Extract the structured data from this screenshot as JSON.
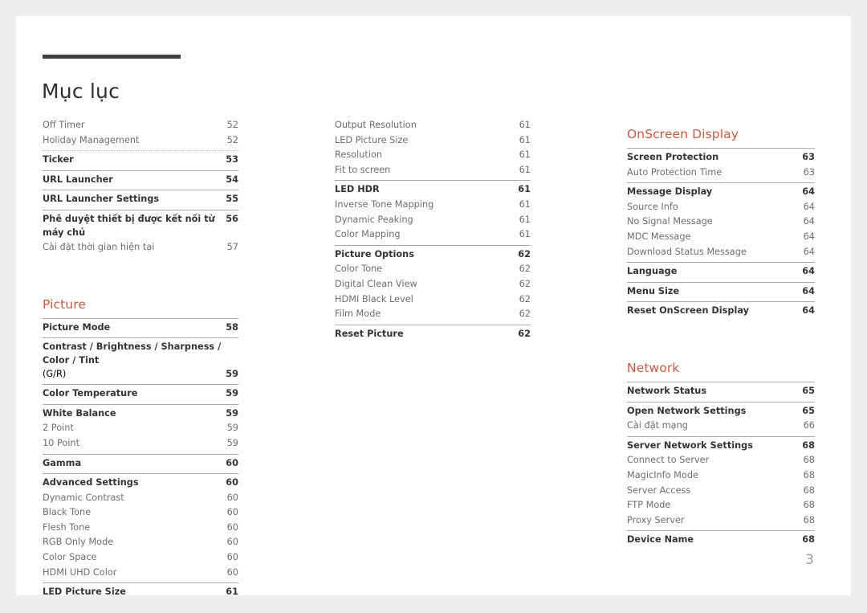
{
  "document": {
    "title": "Mục lục",
    "folio": "3",
    "accent_color": "#d9563a",
    "rule_color": "#3f3f4a"
  },
  "columns": [
    {
      "name": "column-1",
      "groups": [
        {
          "style": "plain",
          "rows": [
            {
              "label": "Off Timer",
              "page": "52",
              "level": 2
            },
            {
              "label": "Holiday Management",
              "page": "52",
              "level": 2
            }
          ]
        },
        {
          "style": "dotted",
          "rows": [
            {
              "label": "Ticker",
              "page": "53",
              "level": 1
            }
          ]
        },
        {
          "style": "solid",
          "rows": [
            {
              "label": "URL Launcher",
              "page": "54",
              "level": 1
            }
          ]
        },
        {
          "style": "solid",
          "rows": [
            {
              "label": "URL Launcher Settings",
              "page": "55",
              "level": 1
            }
          ]
        },
        {
          "style": "solid",
          "rows": [
            {
              "label": "Phê duyệt thiết bị được kết nối từ máy chủ",
              "page": "56",
              "level": 1
            },
            {
              "label": "Cài đặt thời gian hiện tại",
              "page": "57",
              "level": 2
            }
          ]
        }
      ],
      "section": {
        "heading": "Picture",
        "groups": [
          {
            "style": "solid",
            "rows": [
              {
                "label": "Picture Mode",
                "page": "58",
                "level": 1
              }
            ]
          },
          {
            "style": "solid",
            "rows": [
              {
                "label": "Contrast / Brightness / Sharpness / Color / Tint",
                "label2": "(G/R)",
                "page": "59",
                "level": 1,
                "wrap": true
              }
            ]
          },
          {
            "style": "solid",
            "rows": [
              {
                "label": "Color Temperature",
                "page": "59",
                "level": 1
              }
            ]
          },
          {
            "style": "solid",
            "rows": [
              {
                "label": "White Balance",
                "page": "59",
                "level": 1
              },
              {
                "label": "2 Point",
                "page": "59",
                "level": 2
              },
              {
                "label": "10 Point",
                "page": "59",
                "level": 2
              }
            ]
          },
          {
            "style": "solid",
            "rows": [
              {
                "label": "Gamma",
                "page": "60",
                "level": 1
              }
            ]
          },
          {
            "style": "solid",
            "rows": [
              {
                "label": "Advanced Settings",
                "page": "60",
                "level": 1
              },
              {
                "label": "Dynamic Contrast",
                "page": "60",
                "level": 2
              },
              {
                "label": "Black Tone",
                "page": "60",
                "level": 2
              },
              {
                "label": "Flesh Tone",
                "page": "60",
                "level": 2
              },
              {
                "label": "RGB Only Mode",
                "page": "60",
                "level": 2
              },
              {
                "label": "Color Space",
                "page": "60",
                "level": 2
              },
              {
                "label": "HDMI UHD Color",
                "page": "60",
                "level": 2
              }
            ]
          },
          {
            "style": "solid",
            "rows": [
              {
                "label": "LED Picture Size",
                "page": "61",
                "level": 1
              }
            ]
          }
        ]
      }
    },
    {
      "name": "column-2",
      "groups": [
        {
          "style": "plain",
          "rows": [
            {
              "label": "Output Resolution",
              "page": "61",
              "level": 2
            },
            {
              "label": "LED Picture Size",
              "page": "61",
              "level": 2
            },
            {
              "label": "Resolution",
              "page": "61",
              "level": 2
            },
            {
              "label": "Fit to screen",
              "page": "61",
              "level": 2
            }
          ]
        },
        {
          "style": "solid",
          "rows": [
            {
              "label": "LED HDR",
              "page": "61",
              "level": 1
            },
            {
              "label": "Inverse Tone Mapping",
              "page": "61",
              "level": 2
            },
            {
              "label": "Dynamic Peaking",
              "page": "61",
              "level": 2
            },
            {
              "label": "Color Mapping",
              "page": "61",
              "level": 2
            }
          ]
        },
        {
          "style": "solid",
          "rows": [
            {
              "label": "Picture Options",
              "page": "62",
              "level": 1
            },
            {
              "label": "Color Tone",
              "page": "62",
              "level": 2
            },
            {
              "label": "Digital Clean View",
              "page": "62",
              "level": 2
            },
            {
              "label": "HDMI Black Level",
              "page": "62",
              "level": 2
            },
            {
              "label": "Film Mode",
              "page": "62",
              "level": 2
            }
          ]
        },
        {
          "style": "solid",
          "rows": [
            {
              "label": "Reset Picture",
              "page": "62",
              "level": 1
            }
          ]
        }
      ]
    },
    {
      "name": "column-3",
      "sections": [
        {
          "heading": "OnScreen Display",
          "groups": [
            {
              "style": "solid",
              "rows": [
                {
                  "label": "Screen Protection",
                  "page": "63",
                  "level": 1
                },
                {
                  "label": "Auto Protection Time",
                  "page": "63",
                  "level": 2
                }
              ]
            },
            {
              "style": "solid",
              "rows": [
                {
                  "label": "Message Display",
                  "page": "64",
                  "level": 1
                },
                {
                  "label": "Source Info",
                  "page": "64",
                  "level": 2
                },
                {
                  "label": "No Signal Message",
                  "page": "64",
                  "level": 2
                },
                {
                  "label": "MDC Message",
                  "page": "64",
                  "level": 2
                },
                {
                  "label": "Download Status Message",
                  "page": "64",
                  "level": 2
                }
              ]
            },
            {
              "style": "solid",
              "rows": [
                {
                  "label": "Language",
                  "page": "64",
                  "level": 1
                }
              ]
            },
            {
              "style": "solid",
              "rows": [
                {
                  "label": "Menu Size",
                  "page": "64",
                  "level": 1
                }
              ]
            },
            {
              "style": "solid",
              "rows": [
                {
                  "label": "Reset OnScreen Display",
                  "page": "64",
                  "level": 1
                }
              ]
            }
          ]
        },
        {
          "heading": "Network",
          "groups": [
            {
              "style": "solid",
              "rows": [
                {
                  "label": "Network Status",
                  "page": "65",
                  "level": 1
                }
              ]
            },
            {
              "style": "solid",
              "rows": [
                {
                  "label": "Open Network Settings",
                  "page": "65",
                  "level": 1
                },
                {
                  "label": "Cài đặt mạng",
                  "page": "66",
                  "level": 2
                }
              ]
            },
            {
              "style": "solid",
              "rows": [
                {
                  "label": "Server Network Settings",
                  "page": "68",
                  "level": 1
                },
                {
                  "label": "Connect to Server",
                  "page": "68",
                  "level": 2
                },
                {
                  "label": "MagicInfo Mode",
                  "page": "68",
                  "level": 2
                },
                {
                  "label": "Server Access",
                  "page": "68",
                  "level": 2
                },
                {
                  "label": "FTP Mode",
                  "page": "68",
                  "level": 2
                },
                {
                  "label": "Proxy Server",
                  "page": "68",
                  "level": 2
                }
              ]
            },
            {
              "style": "solid",
              "rows": [
                {
                  "label": "Device Name",
                  "page": "68",
                  "level": 1
                }
              ]
            }
          ]
        }
      ]
    }
  ]
}
